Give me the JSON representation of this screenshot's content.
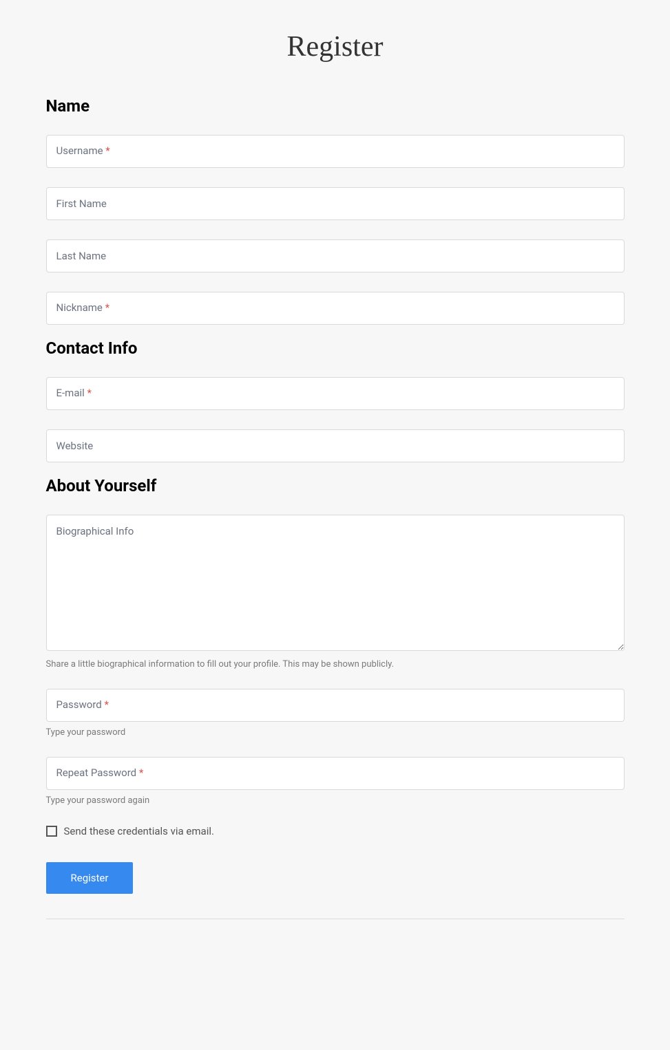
{
  "page": {
    "title": "Register"
  },
  "sections": {
    "name": {
      "heading": "Name",
      "username": {
        "placeholder": "Username",
        "required": "*"
      },
      "first_name": {
        "placeholder": "First Name"
      },
      "last_name": {
        "placeholder": "Last Name"
      },
      "nickname": {
        "placeholder": "Nickname",
        "required": "*"
      }
    },
    "contact": {
      "heading": "Contact Info",
      "email": {
        "placeholder": "E-mail",
        "required": "*"
      },
      "website": {
        "placeholder": "Website"
      }
    },
    "about": {
      "heading": "About Yourself",
      "bio": {
        "placeholder": "Biographical Info",
        "hint": "Share a little biographical information to fill out your profile. This may be shown publicly."
      },
      "password": {
        "placeholder": "Password",
        "required": "*",
        "hint": "Type your password"
      },
      "repeat_password": {
        "placeholder": "Repeat Password",
        "required": "*",
        "hint": "Type your password again"
      },
      "send_email": {
        "label": "Send these credentials via email."
      }
    }
  },
  "actions": {
    "submit": "Register"
  }
}
